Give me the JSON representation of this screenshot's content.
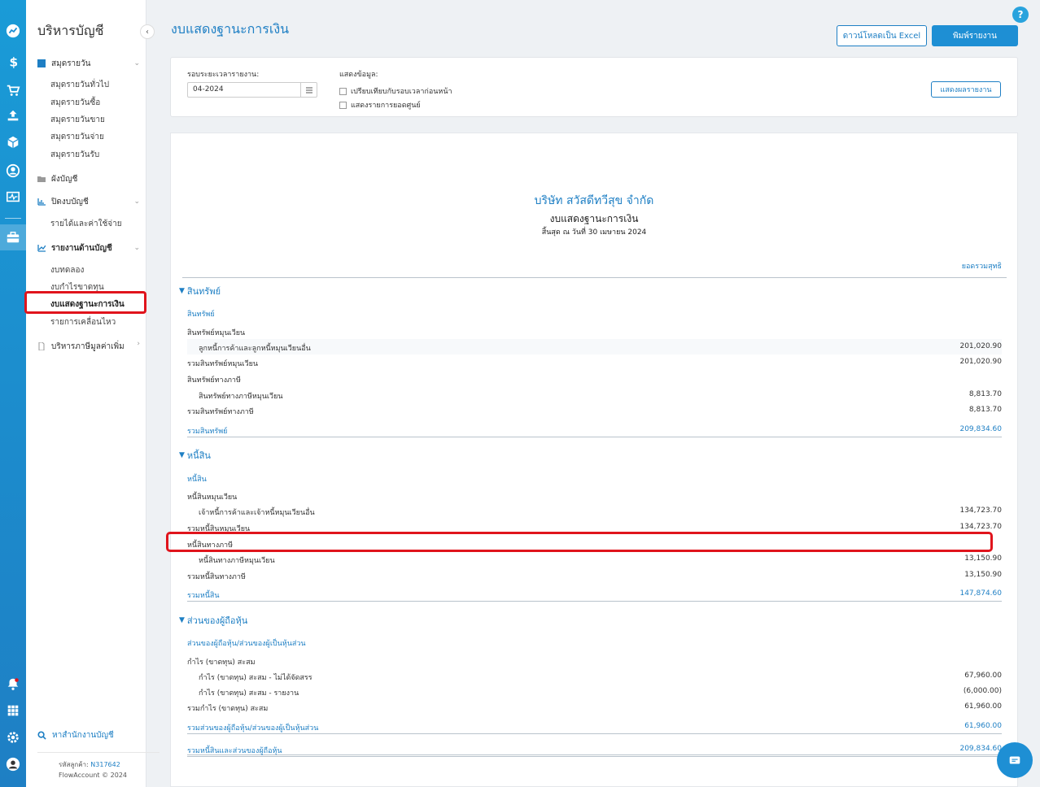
{
  "sidebar": {
    "title": "บริหารบัญชี",
    "sections": [
      {
        "label": "สมุดรายวัน",
        "items": [
          "สมุดรายวันทั่วไป",
          "สมุดรายวันซื้อ",
          "สมุดรายวันขาย",
          "สมุดรายวันจ่าย",
          "สมุดรายวันรับ"
        ]
      },
      {
        "label": "ผังบัญชี"
      },
      {
        "label": "ปิดงบบัญชี",
        "items": [
          "รายได้และค่าใช้จ่าย"
        ]
      },
      {
        "label": "รายงานด้านบัญชี",
        "items": [
          "งบทดลอง",
          "งบกำไรขาดทุน",
          "งบแสดงฐานะการเงิน",
          "รายการเคลื่อนไหว"
        ]
      },
      {
        "label": "บริหารภาษีมูลค่าเพิ่ม"
      }
    ],
    "search_link": "หาสำนักงานบัญชี",
    "customer_id_label": "รหัสลูกค้า:",
    "customer_id": "N317642",
    "copyright": "FlowAccount © 2024"
  },
  "header": {
    "title": "งบแสดงฐานะการเงิน",
    "help": "?",
    "download_excel": "ดาวน์โหลดเป็น Excel",
    "print_report": "พิมพ์รายงาน"
  },
  "filters": {
    "period_label": "รอบระยะเวลารายงาน:",
    "period_value": "04-2024",
    "display_label": "แสดงข้อมูล:",
    "compare_prev": "เปรียบเทียบกับรอบเวลาก่อนหน้า",
    "show_zero": "แสดงรายการยอดศูนย์",
    "show_report": "แสดงผลรายงาน"
  },
  "report": {
    "company": "บริษัท สวัสดีทวีสุข จำกัด",
    "title": "งบแสดงฐานะการเงิน",
    "date_line": "สิ้นสุด ณ วันที่ 30 เมษายน 2024",
    "column_header": "ยอดรวมสุทธิ",
    "assets": {
      "group": "สินทรัพย์",
      "sub": "สินทรัพย์",
      "current_label": "สินทรัพย์หมุนเวียน",
      "receivables_label": "ลูกหนี้การค้าและลูกหนี้หมุนเวียนอื่น",
      "receivables_value": "201,020.90",
      "total_current_label": "รวมสินทรัพย์หมุนเวียน",
      "total_current_value": "201,020.90",
      "tax_label": "สินทรัพย์ทางภาษี",
      "tax_current_label": "สินทรัพย์ทางภาษีหมุนเวียน",
      "tax_current_value": "8,813.70",
      "total_tax_label": "รวมสินทรัพย์ทางภาษี",
      "total_tax_value": "8,813.70",
      "total_label": "รวมสินทรัพย์",
      "total_value": "209,834.60"
    },
    "liabilities": {
      "group": "หนี้สิน",
      "sub": "หนี้สิน",
      "current_label": "หนี้สินหมุนเวียน",
      "payables_label": "เจ้าหนี้การค้าและเจ้าหนี้หมุนเวียนอื่น",
      "payables_value": "134,723.70",
      "total_current_label": "รวมหนี้สินหมุนเวียน",
      "total_current_value": "134,723.70",
      "tax_label": "หนี้สินทางภาษี",
      "tax_current_label": "หนี้สินทางภาษีหมุนเวียน",
      "tax_current_value": "13,150.90",
      "total_tax_label": "รวมหนี้สินทางภาษี",
      "total_tax_value": "13,150.90",
      "total_label": "รวมหนี้สิน",
      "total_value": "147,874.60"
    },
    "equity": {
      "group": "ส่วนของผู้ถือหุ้น",
      "sub": "ส่วนของผู้ถือหุ้น/ส่วนของผู้เป็นหุ้นส่วน",
      "retained_label": "กำไร (ขาดทุน) สะสม",
      "unappropriated_label": "กำไร (ขาดทุน) สะสม - ไม่ได้จัดสรร",
      "unappropriated_value": "67,960.00",
      "report_label": "กำไร (ขาดทุน) สะสม - รายงาน",
      "report_value": "(6,000.00)",
      "total_retained_label": "รวมกำไร (ขาดทุน) สะสม",
      "total_retained_value": "61,960.00",
      "total_label": "รวมส่วนของผู้ถือหุ้น/ส่วนของผู้เป็นหุ้นส่วน",
      "total_value": "61,960.00"
    },
    "grand_total_label": "รวมหนี้สินและส่วนของผู้ถือหุ้น",
    "grand_total_value": "209,834.60"
  },
  "colors": {
    "accent": "#1e7fc4",
    "highlight": "#e0141c"
  }
}
